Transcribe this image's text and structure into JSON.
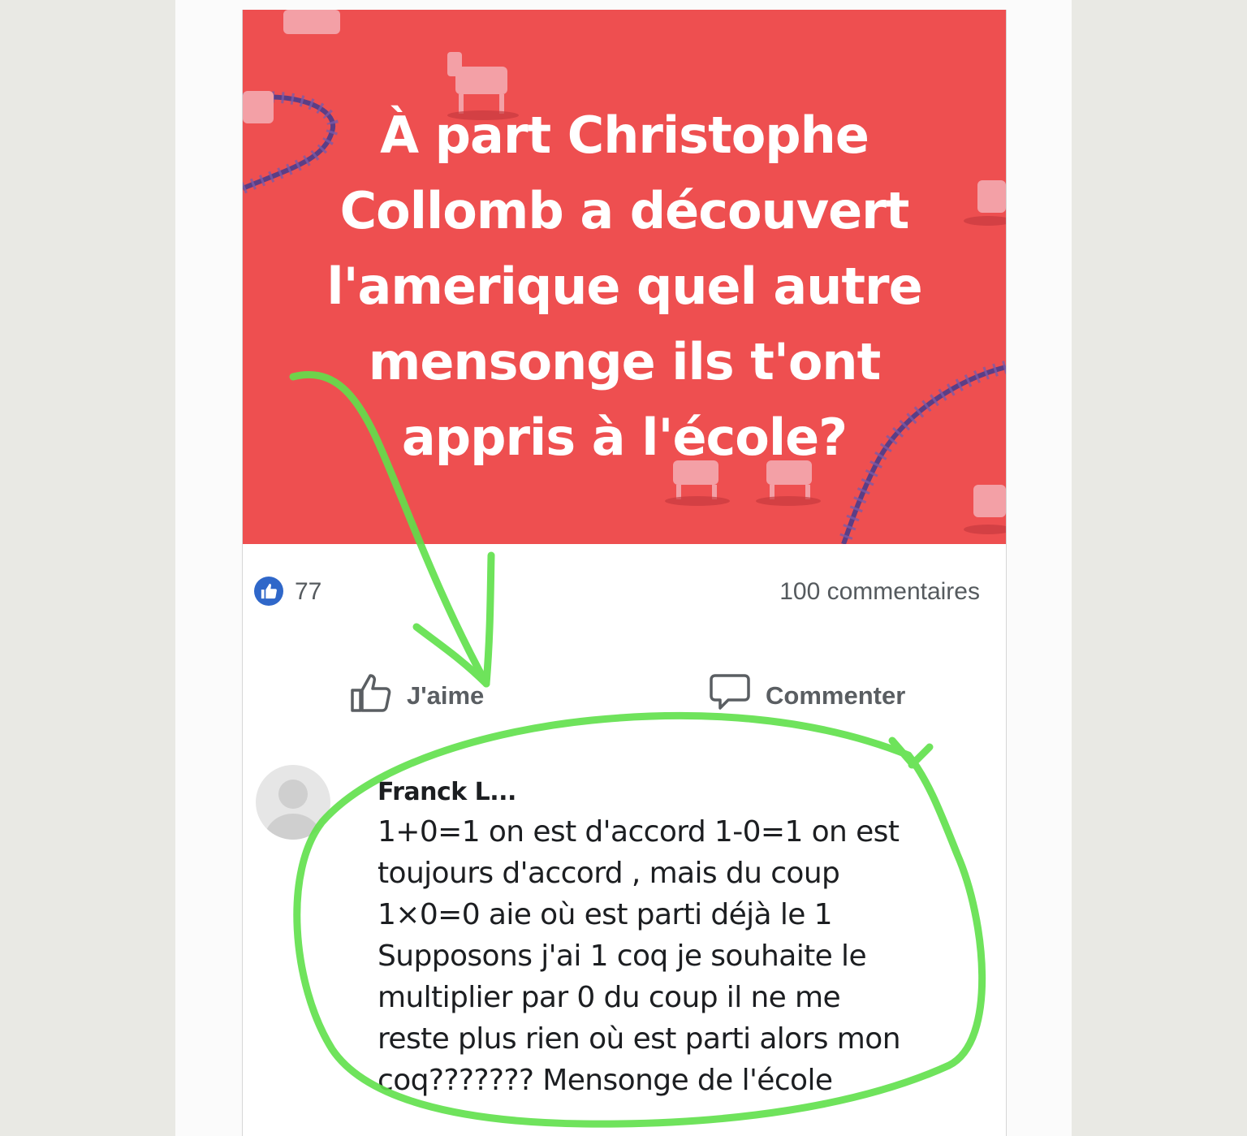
{
  "post": {
    "banner_lines": [
      "À part Christophe",
      "Collomb a découvert",
      "l'amerique quel autre",
      "mensonge ils t'ont",
      "appris à l'école?"
    ],
    "like_count": "77",
    "comments_count": "100 commentaires",
    "like_label": "J'aime",
    "comment_label": "Commenter"
  },
  "comment": {
    "author": "Franck L...",
    "lines": [
      "1+0=1  on est d'accord  1-0=1 on est",
      "toujours d'accord , mais du coup",
      "1×0=0 aie où est parti déjà le 1",
      "Supposons j'ai 1 coq je souhaite le",
      "multiplier par 0 du coup il ne me",
      "reste plus rien où est parti alors mon",
      "coq???????  Mensonge de l'école"
    ]
  },
  "colors": {
    "banner": "#ee4f50",
    "like_badge": "#2f67c9",
    "annotation": "#5fe04a"
  },
  "icons": [
    "thumbs-up-badge-icon",
    "thumbs-up-icon",
    "speech-bubble-icon",
    "avatar-silhouette-icon"
  ]
}
